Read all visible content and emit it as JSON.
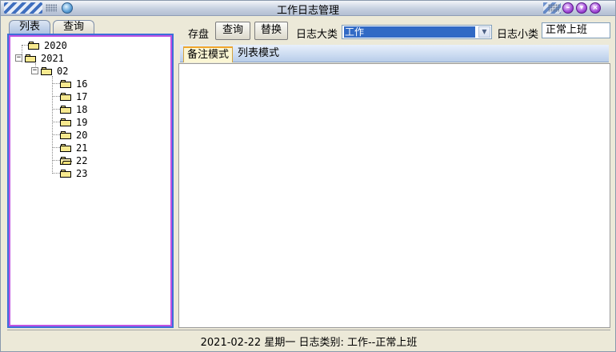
{
  "window": {
    "title": "工作日志管理"
  },
  "left_panel": {
    "tabs": [
      {
        "label": "列表"
      },
      {
        "label": "查询"
      }
    ],
    "tree": {
      "years": [
        {
          "label": "2020",
          "expanded": false
        },
        {
          "label": "2021",
          "expanded": true
        }
      ],
      "month": {
        "label": "02",
        "expanded": true
      },
      "days": [
        {
          "label": "16"
        },
        {
          "label": "17"
        },
        {
          "label": "18"
        },
        {
          "label": "19"
        },
        {
          "label": "20"
        },
        {
          "label": "21"
        },
        {
          "label": "22",
          "selected": true
        },
        {
          "label": "23"
        }
      ]
    }
  },
  "toolbar": {
    "save_label": "存盘",
    "query_button": "查询",
    "replace_button": "替换",
    "category_label": "日志大类",
    "category_value": "工作",
    "subcategory_label": "日志小类",
    "subcategory_value": "正常上班"
  },
  "mode_tabs": [
    {
      "label": "备注模式",
      "active": true
    },
    {
      "label": "列表模式",
      "active": false
    }
  ],
  "status": {
    "text": "2021-02-22 星期一 日志类别: 工作--正常上班"
  },
  "colors": {
    "selection": "#316ac5",
    "tree_border_outer": "#3c6fd8",
    "tree_border_inner": "#c052e2",
    "active_tab_accent": "#f0a52a"
  }
}
